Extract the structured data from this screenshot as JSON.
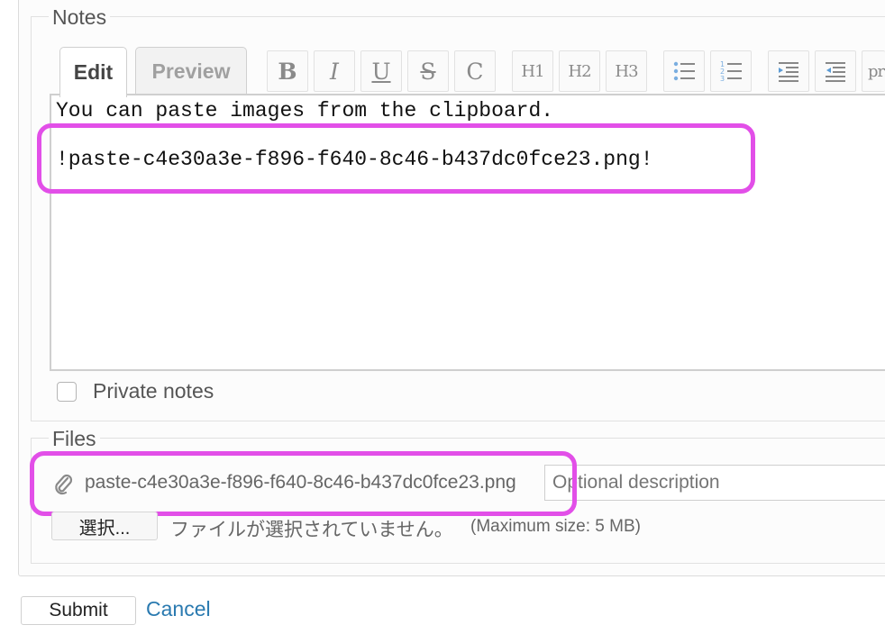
{
  "notes_section": {
    "legend": "Notes",
    "tabs": {
      "edit": "Edit",
      "preview": "Preview"
    },
    "toolbar": {
      "bold": "B",
      "italic": "I",
      "underline": "U",
      "strike": "S",
      "code": "C",
      "h1": "H1",
      "h2": "H2",
      "h3": "H3",
      "pre": "pr"
    },
    "editor": {
      "line1": "You can paste images from the clipboard.",
      "line2": "!paste-c4e30a3e-f896-f640-8c46-b437dc0fce23.png!"
    },
    "private_notes_label": "Private notes"
  },
  "files_section": {
    "legend": "Files",
    "attachment_filename": "paste-c4e30a3e-f896-f640-8c46-b437dc0fce23.png",
    "description_placeholder": "Optional description",
    "choose_button": "選択...",
    "no_file_text": "ファイルが選択されていません。",
    "max_size_text": "(Maximum size: 5 MB)"
  },
  "actions": {
    "submit": "Submit",
    "cancel": "Cancel"
  },
  "colors": {
    "highlight": "#e24fe8",
    "link": "#2a7ab0"
  }
}
